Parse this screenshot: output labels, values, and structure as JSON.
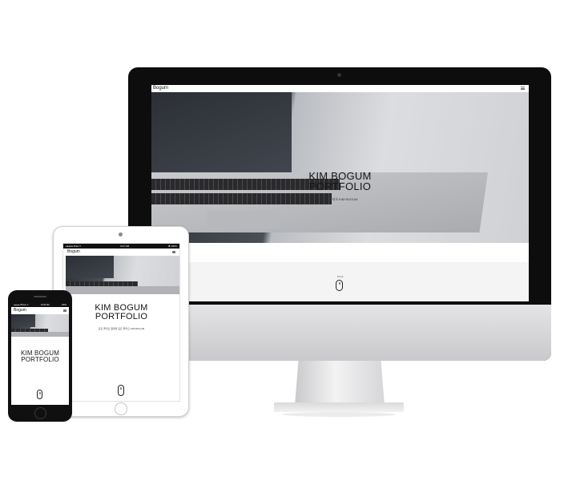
{
  "site": {
    "logo": "Bogum",
    "title_line1": "KIM BOGUM",
    "title_line2": "PORTFOLIO",
    "imac_subtitle": "포트 폴리오 KIM BOGUM",
    "ipad_subtitle": "포트 폴리오 웹퍼블 포트 폴리오 KIM BOGUM",
    "scroll_label": "Scroll",
    "menu_icon": "hamburger-menu-icon"
  },
  "ipad_status": {
    "left": "●●●●● iPad ✦",
    "time": "9:27 AM",
    "right": "✱ 100%"
  },
  "iphone_status": {
    "left": "●●●●● iPhone ✦",
    "time": "10:00 AM",
    "right": "100%"
  }
}
